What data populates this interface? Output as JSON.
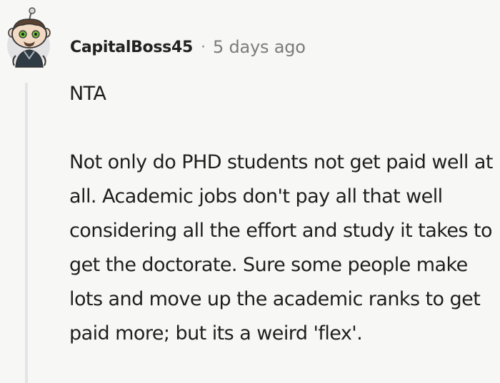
{
  "comment": {
    "author": "CapitalBoss45",
    "separator": "·",
    "timestamp": "5 days ago",
    "paragraphs": [
      "NTA",
      "Not only do PHD students not get paid well at all. Academic jobs don't pay all that well considering all the effort and study it takes to get the doctorate. Sure some people make lots and move up the academic ranks to get paid more; but its a weird 'flex'."
    ]
  },
  "avatar": {
    "icon": "snoo-avatar-icon",
    "colors": {
      "face": "#f2d9c4",
      "hair": "#5a4030",
      "eyes": "#6fbf3a",
      "shirt": "#2f3b45",
      "background": "#e2e2e4"
    }
  },
  "colors": {
    "background": "#f7f7f6",
    "text": "#1f1f1f",
    "muted": "#7b7b7b",
    "thread_line": "#e4e4e8"
  }
}
